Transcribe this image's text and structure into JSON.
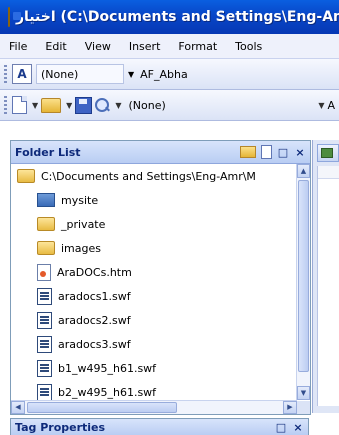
{
  "window": {
    "title": "اختيار (C:\\Documents and Settings\\Eng-Amr",
    "accent": "#0846c8"
  },
  "menu": {
    "items": [
      "File",
      "Edit",
      "View",
      "Insert",
      "Format",
      "Tools"
    ]
  },
  "toolbar_formatting": {
    "style_value": "(None)",
    "font_value": "AF_Abha"
  },
  "toolbar_standard": {
    "style_value": "(None)",
    "trailing_label": "A"
  },
  "folder_list": {
    "title": "Folder List",
    "close_glyph": "×",
    "maximize_glyph": "□",
    "root_path": "C:\\Documents and Settings\\Eng-Amr\\M",
    "items": [
      {
        "label": "mysite",
        "icon": "web-folder-icon"
      },
      {
        "label": "_private",
        "icon": "folder-icon"
      },
      {
        "label": "images",
        "icon": "folder-icon"
      },
      {
        "label": "AraDOCs.htm",
        "icon": "html-file-icon"
      },
      {
        "label": "aradocs1.swf",
        "icon": "swf-file-icon"
      },
      {
        "label": "aradocs2.swf",
        "icon": "swf-file-icon"
      },
      {
        "label": "aradocs3.swf",
        "icon": "swf-file-icon"
      },
      {
        "label": "b1_w495_h61.swf",
        "icon": "swf-file-icon"
      },
      {
        "label": "b2_w495_h61.swf",
        "icon": "swf-file-icon"
      }
    ]
  },
  "tag_properties": {
    "title": "Tag Properties",
    "close_glyph": "×",
    "maximize_glyph": "□"
  }
}
